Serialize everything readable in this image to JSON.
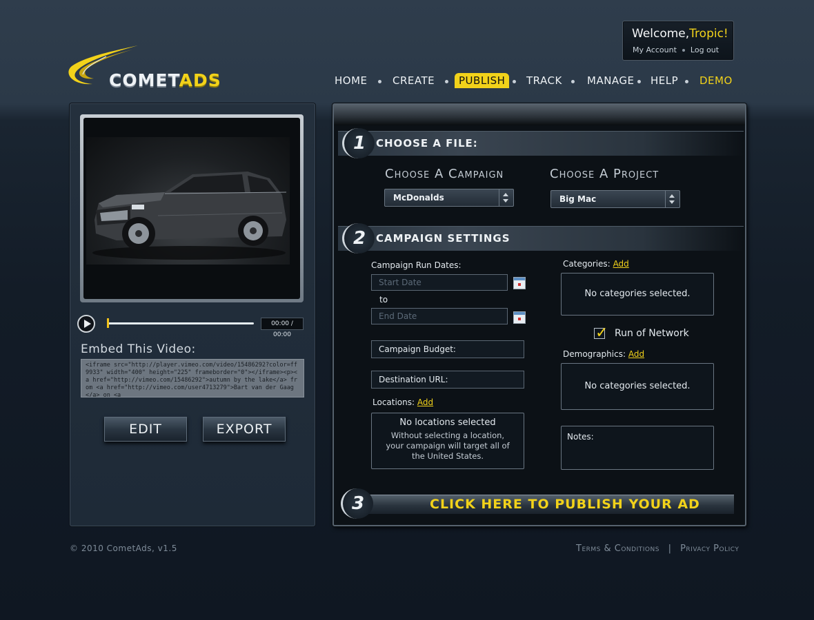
{
  "brand": {
    "name_part1": "COMET",
    "name_part2": "ADS"
  },
  "account": {
    "greeting": "Welcome,",
    "username": "Tropic!",
    "my_account": "My Account",
    "logout": "Log out"
  },
  "nav": {
    "home": "HOME",
    "create": "CREATE",
    "publish": "PUBLISH",
    "track": "TRACK",
    "manage": "MANAGE",
    "help": "HELP",
    "demo": "DEMO",
    "active": "PUBLISH"
  },
  "player": {
    "time": "00:00 / 00:00",
    "progress": 0,
    "embed_label": "Embed This Video:",
    "embed_code": "<iframe src=\"http://player.vimeo.com/video/15486292?color=ff9933\" width=\"400\" height=\"225\" frameborder=\"0\"></iframe><p><a href=\"http://vimeo.com/15486292\">autumn by the lake</a> from <a href=\"http://vimeo.com/user4713279\">Bart van der Gaag</a> on <a",
    "edit_label": "EDIT",
    "export_label": "EXPORT"
  },
  "step1": {
    "number": "1",
    "title": "CHOOSE A FILE:",
    "campaign_label": "Choose A Campaign",
    "campaign_value": "McDonalds",
    "project_label": "Choose A Project",
    "project_value": "Big Mac"
  },
  "step2": {
    "number": "2",
    "title": "CAMPAIGN SETTINGS",
    "run_dates_label": "Campaign Run Dates:",
    "start_placeholder": "Start Date",
    "to_label": "to",
    "end_placeholder": "End Date",
    "budget_label": "Campaign Budget:",
    "url_label": "Destination URL:",
    "locations_label": "Locations:",
    "add_label": "Add",
    "locations_title": "No locations selected",
    "locations_desc": "Without selecting a location, your campaign will target all of the United States.",
    "categories_label": "Categories:",
    "categories_empty": "No categories selected.",
    "run_of_network": "Run of Network",
    "demographics_label": "Demographics:",
    "demographics_empty": "No categories selected.",
    "notes_label": "Notes:"
  },
  "step3": {
    "number": "3",
    "label": "CLICK HERE TO PUBLISH YOUR AD"
  },
  "footer": {
    "copyright": "© 2010 CometAds, v1.5",
    "terms": "Terms & Conditions",
    "separator": "|",
    "privacy": "Privacy Policy"
  },
  "colors": {
    "accent": "#f2d21a",
    "background": "#131c27",
    "panel": "#0c1116"
  },
  "icons": [
    "comet-logo-icon",
    "play-icon",
    "calendar-icon",
    "checkmark-icon",
    "dropdown-arrow-icon"
  ]
}
